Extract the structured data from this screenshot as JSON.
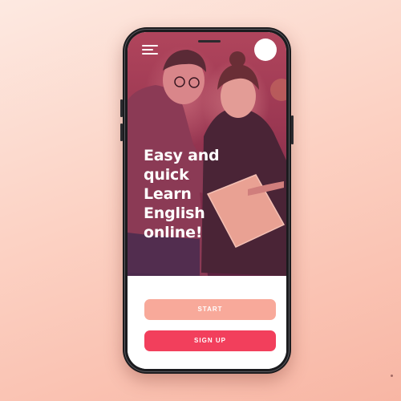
{
  "hero": {
    "headline": [
      "Easy and",
      "quick",
      "Learn",
      "English",
      "online!"
    ],
    "menu_icon": "hamburger-menu-icon",
    "avatar_icon": "profile-avatar-icon"
  },
  "actions": {
    "start_label": "START",
    "signup_label": "SIGN UP"
  },
  "colors": {
    "start_button": "#f8a99a",
    "signup_button": "#f23f5c",
    "hero_tint": "#9a3752",
    "background": "#fcd2c4"
  }
}
